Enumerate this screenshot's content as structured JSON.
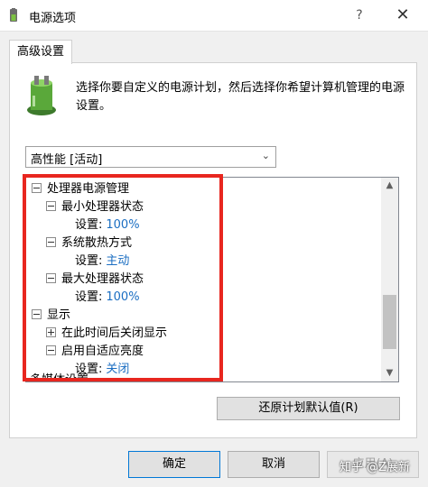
{
  "window": {
    "title": "电源选项",
    "help_glyph": "?",
    "close_glyph": "✕"
  },
  "tab": {
    "label": "高级设置"
  },
  "description": "选择你要自定义的电源计划，然后选择你希望计算机管理的电源设置。",
  "plan_select": {
    "value": "高性能 [活动]"
  },
  "tree": {
    "rows": [
      {
        "label": "处理器电源管理",
        "level": 0,
        "toggle": "minus"
      },
      {
        "label": "最小处理器状态",
        "level": 1,
        "toggle": "minus"
      },
      {
        "label": "设置:",
        "value": "100%",
        "level": 2
      },
      {
        "label": "系统散热方式",
        "level": 1,
        "toggle": "minus"
      },
      {
        "label": "设置:",
        "value": "主动",
        "level": 2
      },
      {
        "label": "最大处理器状态",
        "level": 1,
        "toggle": "minus"
      },
      {
        "label": "设置:",
        "value": "100%",
        "level": 2
      },
      {
        "label": "显示",
        "level": 0,
        "toggle": "minus"
      },
      {
        "label": "在此时间后关闭显示",
        "level": 1,
        "toggle": "plus"
      },
      {
        "label": "启用自适应亮度",
        "level": 1,
        "toggle": "minus"
      },
      {
        "label": "设置:",
        "value": "关闭",
        "level": 2
      }
    ],
    "cut_row": "多媒体设置"
  },
  "buttons": {
    "restore": "还原计划默认值(R)",
    "ok": "确定",
    "cancel": "取消",
    "apply": "应用(A)"
  },
  "watermark": "知乎 @Z展新",
  "colors": {
    "highlight_box": "#e8261f",
    "setting_value": "#1b6ec2"
  }
}
